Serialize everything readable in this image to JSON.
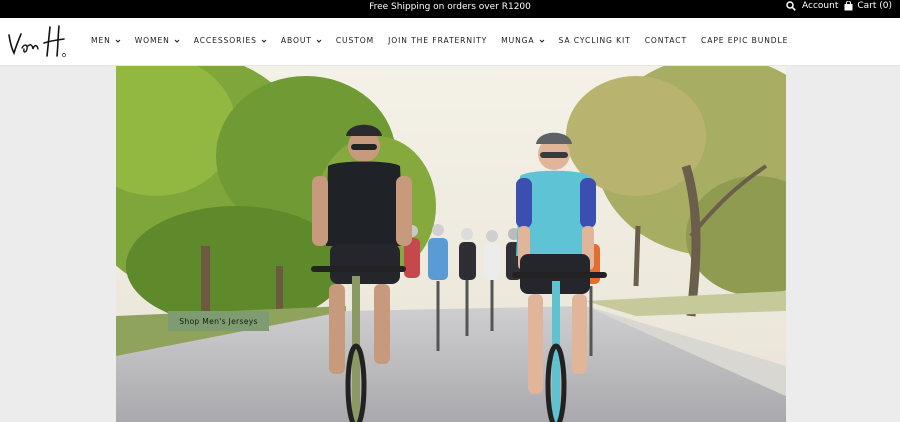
{
  "announcement": {
    "text": "Free Shipping on orders over R1200"
  },
  "utility": {
    "search_icon": "search-icon",
    "account_label": "Account",
    "cart_label": "Cart (0)",
    "cart_icon": "bag-icon"
  },
  "brand": {
    "logo_icon": "van-h-signature-logo"
  },
  "nav": {
    "items": [
      {
        "label": "MEN",
        "has_dropdown": true
      },
      {
        "label": "WOMEN",
        "has_dropdown": true
      },
      {
        "label": "ACCESSORIES",
        "has_dropdown": true
      },
      {
        "label": "ABOUT",
        "has_dropdown": true
      },
      {
        "label": "CUSTOM",
        "has_dropdown": false
      },
      {
        "label": "JOIN THE FRATERNITY",
        "has_dropdown": false
      },
      {
        "label": "MUNGA",
        "has_dropdown": true
      },
      {
        "label": "SA CYCLING KIT",
        "has_dropdown": false
      },
      {
        "label": "CONTACT",
        "has_dropdown": false
      },
      {
        "label": "CAPE EPIC BUNDLE",
        "has_dropdown": false
      }
    ]
  },
  "hero": {
    "cta_label": "Shop Men's Jerseys",
    "image_subject": "group-of-cyclists-on-tree-lined-road"
  },
  "colors": {
    "topbar": "#000000",
    "cta": "#7f9b71",
    "page_bg": "#ececec"
  }
}
